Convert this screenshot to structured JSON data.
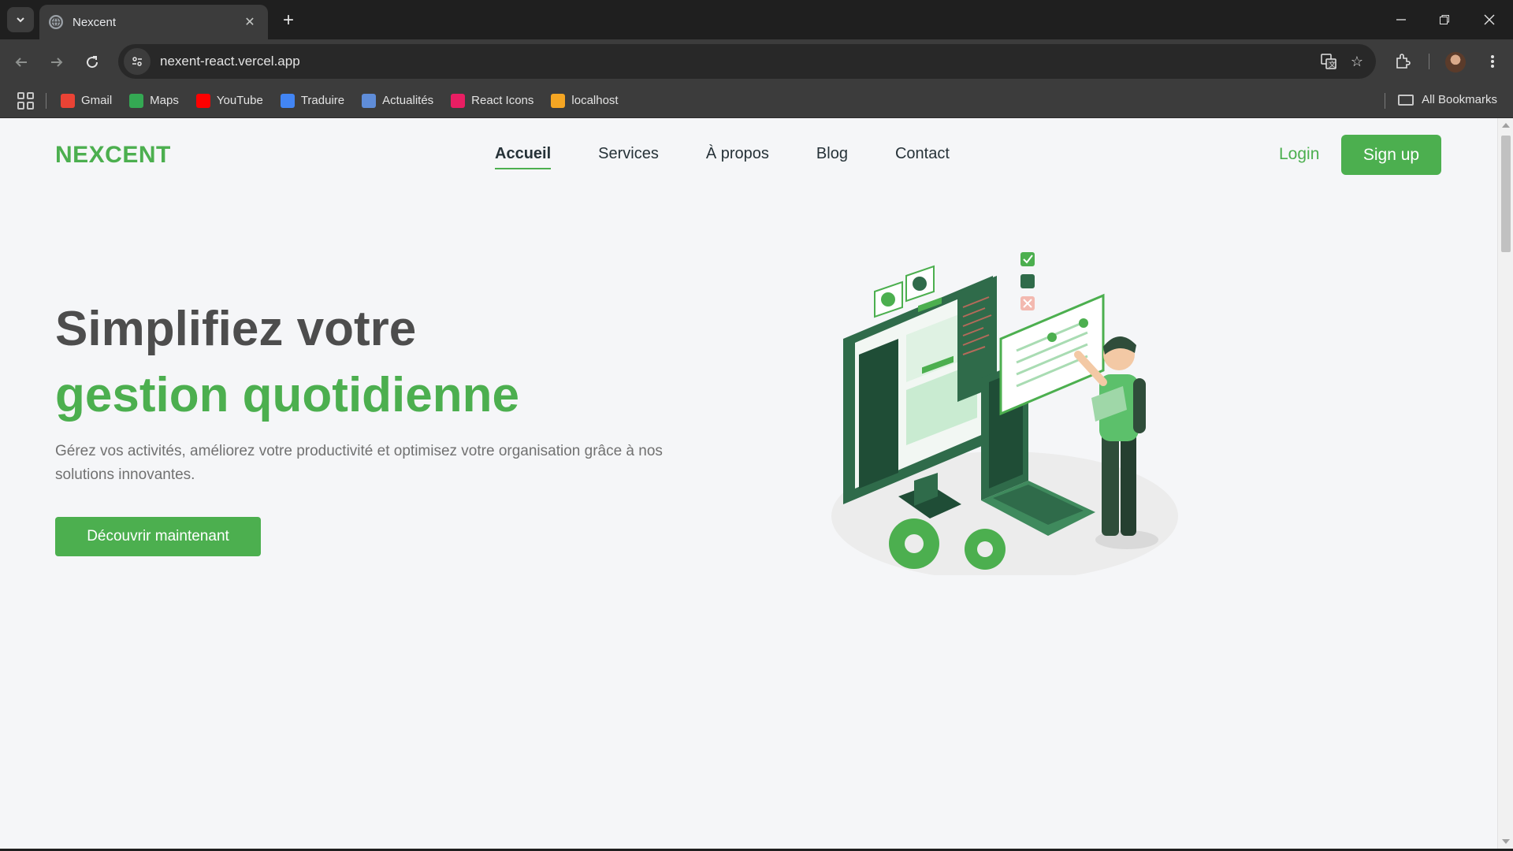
{
  "browser": {
    "tab_title": "Nexcent",
    "url": "nexent-react.vercel.app",
    "bookmarks": [
      {
        "label": "Gmail",
        "color": "#ea4335"
      },
      {
        "label": "Maps",
        "color": "#34a853"
      },
      {
        "label": "YouTube",
        "color": "#ff0000"
      },
      {
        "label": "Traduire",
        "color": "#4285f4"
      },
      {
        "label": "Actualités",
        "color": "#5f8dd9"
      },
      {
        "label": "React Icons",
        "color": "#e91e63"
      },
      {
        "label": "localhost",
        "color": "#f5a623"
      }
    ],
    "all_bookmarks": "All Bookmarks"
  },
  "site": {
    "logo": "NEXCENT",
    "nav": [
      "Accueil",
      "Services",
      "À propos",
      "Blog",
      "Contact"
    ],
    "active_nav": "Accueil",
    "login": "Login",
    "signup": "Sign up",
    "accent_color": "#4caf4f"
  },
  "hero": {
    "title_line1": "Simplifiez votre",
    "title_line2": "gestion quotidienne",
    "description": "Gérez vos activités, améliorez votre productivité et optimisez votre organisation grâce à nos solutions innovantes.",
    "cta": "Découvrir maintenant"
  }
}
